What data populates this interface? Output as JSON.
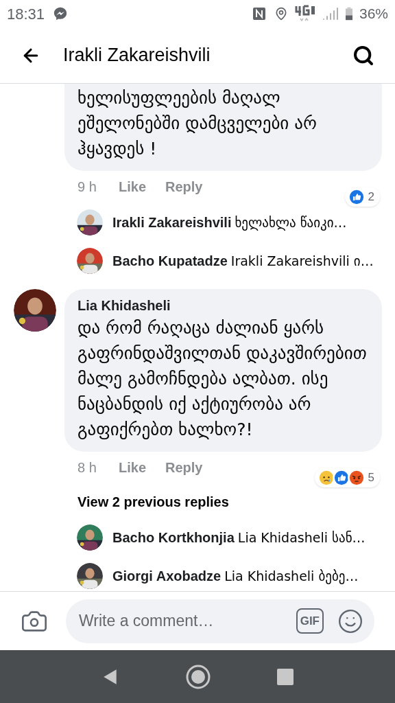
{
  "status_bar": {
    "time": "18:31",
    "battery": "36%"
  },
  "header": {
    "title": "Irakli Zakareishvili"
  },
  "comments": [
    {
      "text": "ხელისუფლეების მაღალ ეშელონებში დამცველები არ ჰყავდეს !",
      "time": "9 h",
      "actions": [
        "Like",
        "Reply"
      ],
      "reactions": [
        {
          "kind": "like"
        }
      ],
      "reaction_count": "2",
      "replies": [
        {
          "author": "Irakli Zakareishvili",
          "text": "ხელახლა წაიკი…"
        },
        {
          "author": "Bacho Kupatadze",
          "text": "Irakli Zakareishvili ი…"
        }
      ]
    },
    {
      "author": "Lia Khidasheli",
      "text": "და რომ რაღაცა  ძალიან ყარს გაფრინდაშვილთან დაკავშირებით მალე გამოჩნდება ალბათ. ისე ნაცბანდის იქ აქტიურობა არ გაფიქრებთ ხალხო?!",
      "time": "8 h",
      "actions": [
        "Like",
        "Reply"
      ],
      "reactions": [
        {
          "kind": "sad"
        },
        {
          "kind": "like"
        },
        {
          "kind": "angry"
        }
      ],
      "reaction_count": "5",
      "view_previous": "View 2 previous replies",
      "replies": [
        {
          "author": "Bacho Kortkhonjia",
          "text": "Lia Khidasheli სან…"
        },
        {
          "author": "Giorgi Axobadze",
          "text": "Lia Khidasheli ბებე…"
        }
      ]
    }
  ],
  "composer": {
    "placeholder": "Write a comment…",
    "gif": "GIF"
  }
}
